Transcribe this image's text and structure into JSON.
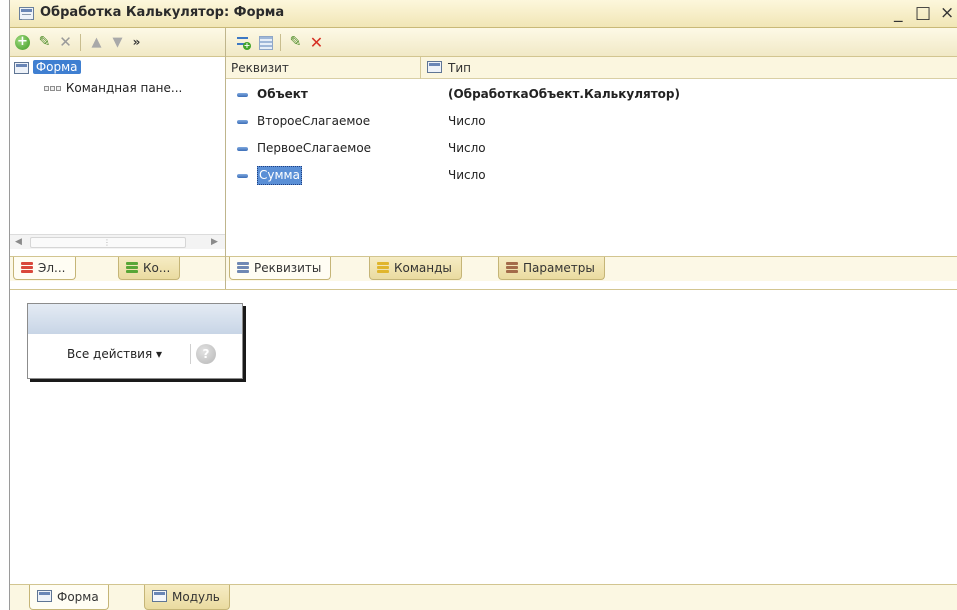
{
  "window": {
    "title": "Обработка Калькулятор: Форма",
    "controls": {
      "minimize": "_",
      "maximize": "□",
      "close": "×"
    }
  },
  "left_toolbar": {
    "icons": [
      "add-icon",
      "edit-pencil-icon",
      "delete-icon",
      "move-up-icon",
      "move-down-icon",
      "more-icon"
    ],
    "more_label": "»"
  },
  "tree": {
    "items": [
      {
        "label": "Форма",
        "icon": "form-icon",
        "selected": true
      },
      {
        "label": "Командная пане...",
        "icon": "command-panel-icon",
        "selected": false
      }
    ]
  },
  "left_tabs": [
    {
      "label": "Эл...",
      "icon": "elements-icon",
      "active": true
    },
    {
      "label": "Ко...",
      "icon": "commands-icon",
      "active": false
    }
  ],
  "right_toolbar": {
    "icons": [
      "add-attribute-icon",
      "add-table-icon",
      "edit-pencil-icon",
      "delete-icon"
    ]
  },
  "attributes_table": {
    "columns": [
      "Реквизит",
      "Тип"
    ],
    "rows": [
      {
        "name": "Объект",
        "type": "(ОбработкаОбъект.Калькулятор)",
        "bold": true
      },
      {
        "name": "ВтороеСлагаемое",
        "type": "Число"
      },
      {
        "name": "ПервоеСлагаемое",
        "type": "Число"
      },
      {
        "name": "Сумма",
        "type": "Число",
        "selected": true
      }
    ]
  },
  "right_tabs": [
    {
      "label": "Реквизиты",
      "active": true
    },
    {
      "label": "Команды",
      "active": false
    },
    {
      "label": "Параметры",
      "active": false
    }
  ],
  "form_preview": {
    "all_actions": "Все действия ▾",
    "help": "?"
  },
  "bottom_tabs": [
    {
      "label": "Форма",
      "icon": "form-icon",
      "active": true
    },
    {
      "label": "Модуль",
      "icon": "module-icon",
      "active": false
    }
  ],
  "colors": {
    "selection": "#3f7fd1",
    "toolbar_bg": "#f6efd2",
    "tab_bg": "#eadba0"
  }
}
